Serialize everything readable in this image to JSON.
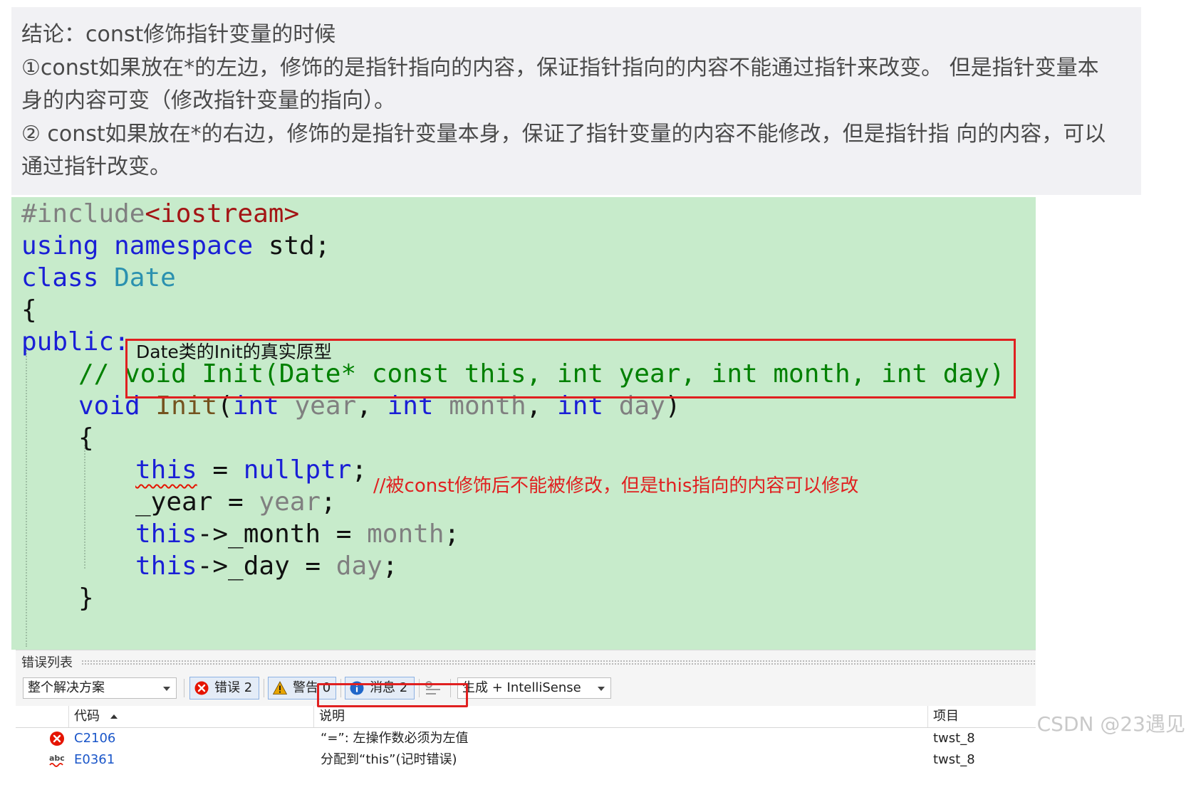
{
  "note": {
    "line1": "结论：const修饰指针变量的时候",
    "line2": "①const如果放在*的左边，修饰的是指针指向的内容，保证指针指向的内容不能通过指针来改变。 但是指针变量本",
    "line3": "身的内容可变（修改指针变量的指向）。",
    "line4": "② const如果放在*的右边，修饰的是指针变量本身，保证了指针变量的内容不能修改，但是指针指 向的内容，可以",
    "line5": "通过指针改变。"
  },
  "code": {
    "l1_directive": "#include",
    "l1_header": "<iostream>",
    "l2_using": "using",
    "l2_namespace": "namespace",
    "l2_rest": " std;",
    "l3_class": "class",
    "l3_name": "Date",
    "l4": "{",
    "l5_public": "public:",
    "l6_comment_prefix": "//",
    "l6_comment_code": "void Init(Date* const this, int year, int month, int day)",
    "l7_void": "void",
    "l7_init": "Init",
    "l7_p1": "(",
    "l7_int1": "int",
    "l7_year": "year",
    "l7_c1": ", ",
    "l7_int2": "int",
    "l7_month": "month",
    "l7_c2": ", ",
    "l7_int3": "int",
    "l7_day": "day",
    "l7_p2": ")",
    "l8": "{",
    "l9_this": "this",
    "l9_eq": " = ",
    "l9_null": "nullptr",
    "l9_semi": ";",
    "l10_member": "_year = ",
    "l10_param": "year",
    "l10_semi": ";",
    "l11_this": "this",
    "l11_rest": "->_month = ",
    "l11_param": "month",
    "l11_semi": ";",
    "l12_this": "this",
    "l12_rest": "->_day = ",
    "l12_param": "day",
    "l12_semi": ";",
    "l13": "}"
  },
  "annotations": {
    "box_label": "Date类的Init的真实原型",
    "inline_comment": "//被const修饰后不能被修改，但是this指向的内容可以修改"
  },
  "error_list": {
    "title": "错误列表",
    "scope": "整个解决方案",
    "errors_label": "错误 2",
    "warnings_label": "警告 0",
    "messages_label": "消息 2",
    "build_filter": "生成 + IntelliSense",
    "columns": {
      "code": "代码",
      "description": "说明",
      "project": "项目"
    },
    "rows": [
      {
        "code": "C2106",
        "description": "“=”: 左操作数必须为左值",
        "project": "twst_8"
      },
      {
        "code": "E0361",
        "description": "分配到“this”(记时错误)",
        "project": "twst_8"
      }
    ]
  },
  "watermark": "CSDN @23遇见",
  "colors": {
    "editor_bg": "#c7ebcb",
    "note_bg": "#f1f1f4",
    "annotation_red": "#e02020",
    "error_red": "#e51400"
  }
}
